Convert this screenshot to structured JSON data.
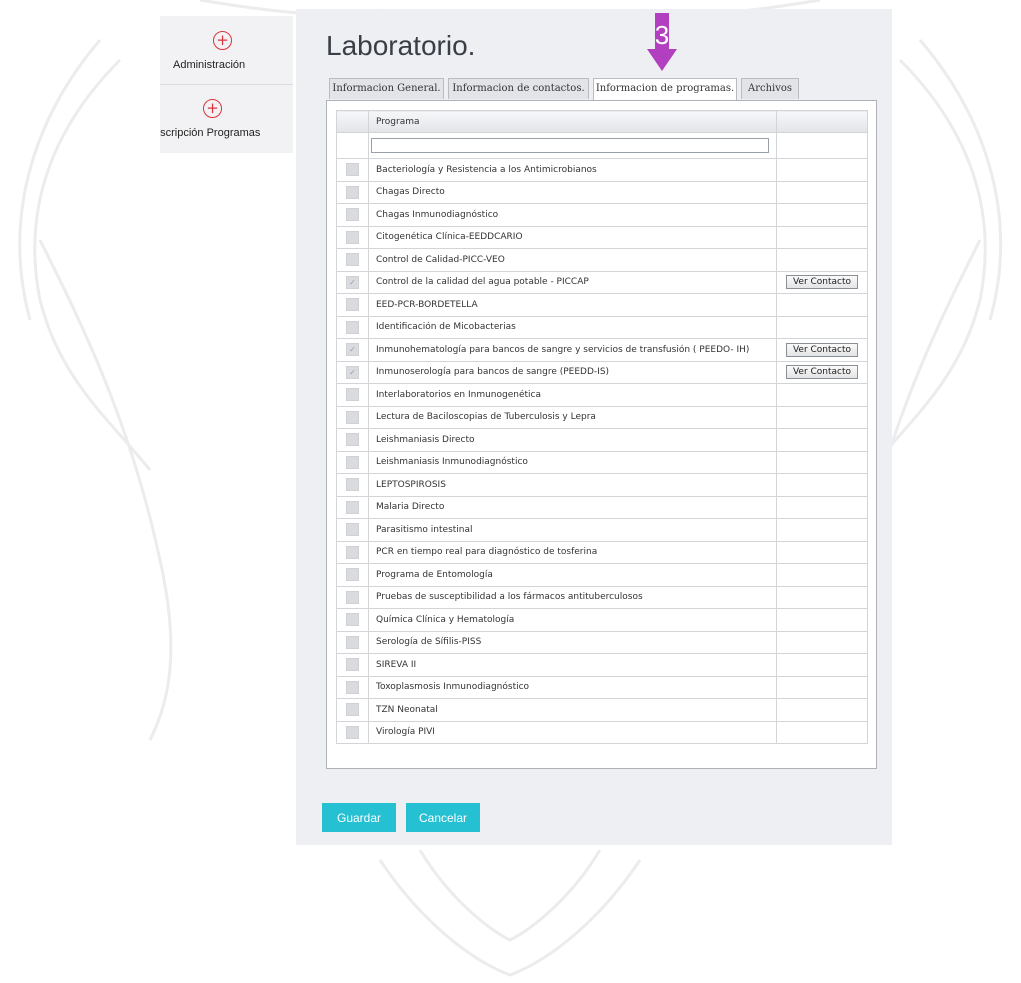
{
  "colors": {
    "accent": "#26c0d3",
    "arrow": "#b23fbf",
    "sidebar_icon": "#d9343b"
  },
  "sidebar": {
    "items": [
      {
        "label": "Administración",
        "icon": "plus-circle-icon"
      },
      {
        "label": "nscripción Programas",
        "icon": "plus-circle-icon"
      }
    ]
  },
  "page": {
    "title": "Laboratorio.",
    "annotation_number": "3"
  },
  "tabs": [
    {
      "label": "Informacion General."
    },
    {
      "label": "Informacion de contactos."
    },
    {
      "label": "Informacion de programas.",
      "active": true
    },
    {
      "label": "Archivos"
    }
  ],
  "table": {
    "header": "Programa",
    "filter_placeholder": "",
    "rows": [
      {
        "name": "Bacteriología y Resistencia a los Antimicrobianos",
        "checked": false,
        "action": ""
      },
      {
        "name": "Chagas Directo",
        "checked": false,
        "action": ""
      },
      {
        "name": "Chagas Inmunodiagnóstico",
        "checked": false,
        "action": ""
      },
      {
        "name": "Citogenética Clínica-EEDDCARIO",
        "checked": false,
        "action": ""
      },
      {
        "name": "Control de Calidad-PICC-VEO",
        "checked": false,
        "action": ""
      },
      {
        "name": "Control de la calidad del agua potable - PICCAP",
        "checked": true,
        "action": "Ver Contacto"
      },
      {
        "name": "EED-PCR-BORDETELLA",
        "checked": false,
        "action": ""
      },
      {
        "name": "Identificación de Micobacterias",
        "checked": false,
        "action": ""
      },
      {
        "name": "Inmunohematología para bancos de sangre y servicios de transfusión ( PEEDO- IH)",
        "checked": true,
        "action": "Ver Contacto"
      },
      {
        "name": "Inmunoserología para bancos de sangre (PEEDD-IS)",
        "checked": true,
        "action": "Ver Contacto"
      },
      {
        "name": "Interlaboratorios en Inmunogenética",
        "checked": false,
        "action": ""
      },
      {
        "name": "Lectura de Baciloscopias de Tuberculosis y Lepra",
        "checked": false,
        "action": ""
      },
      {
        "name": "Leishmaniasis Directo",
        "checked": false,
        "action": ""
      },
      {
        "name": "Leishmaniasis Inmunodiagnóstico",
        "checked": false,
        "action": ""
      },
      {
        "name": "LEPTOSPIROSIS",
        "checked": false,
        "action": ""
      },
      {
        "name": "Malaria Directo",
        "checked": false,
        "action": ""
      },
      {
        "name": "Parasitismo intestinal",
        "checked": false,
        "action": ""
      },
      {
        "name": "PCR en tiempo real para diagnóstico de tosferina",
        "checked": false,
        "action": ""
      },
      {
        "name": "Programa de Entomología",
        "checked": false,
        "action": ""
      },
      {
        "name": "Pruebas de susceptibilidad a los fármacos antituberculosos",
        "checked": false,
        "action": ""
      },
      {
        "name": "Química Clínica y Hematología",
        "checked": false,
        "action": ""
      },
      {
        "name": "Serología de Sífilis-PISS",
        "checked": false,
        "action": ""
      },
      {
        "name": "SIREVA II",
        "checked": false,
        "action": ""
      },
      {
        "name": "Toxoplasmosis Inmunodiagnóstico",
        "checked": false,
        "action": ""
      },
      {
        "name": "TZN Neonatal",
        "checked": false,
        "action": ""
      },
      {
        "name": "Virología PIVI",
        "checked": false,
        "action": ""
      }
    ]
  },
  "buttons": {
    "save": "Guardar",
    "cancel": "Cancelar"
  }
}
